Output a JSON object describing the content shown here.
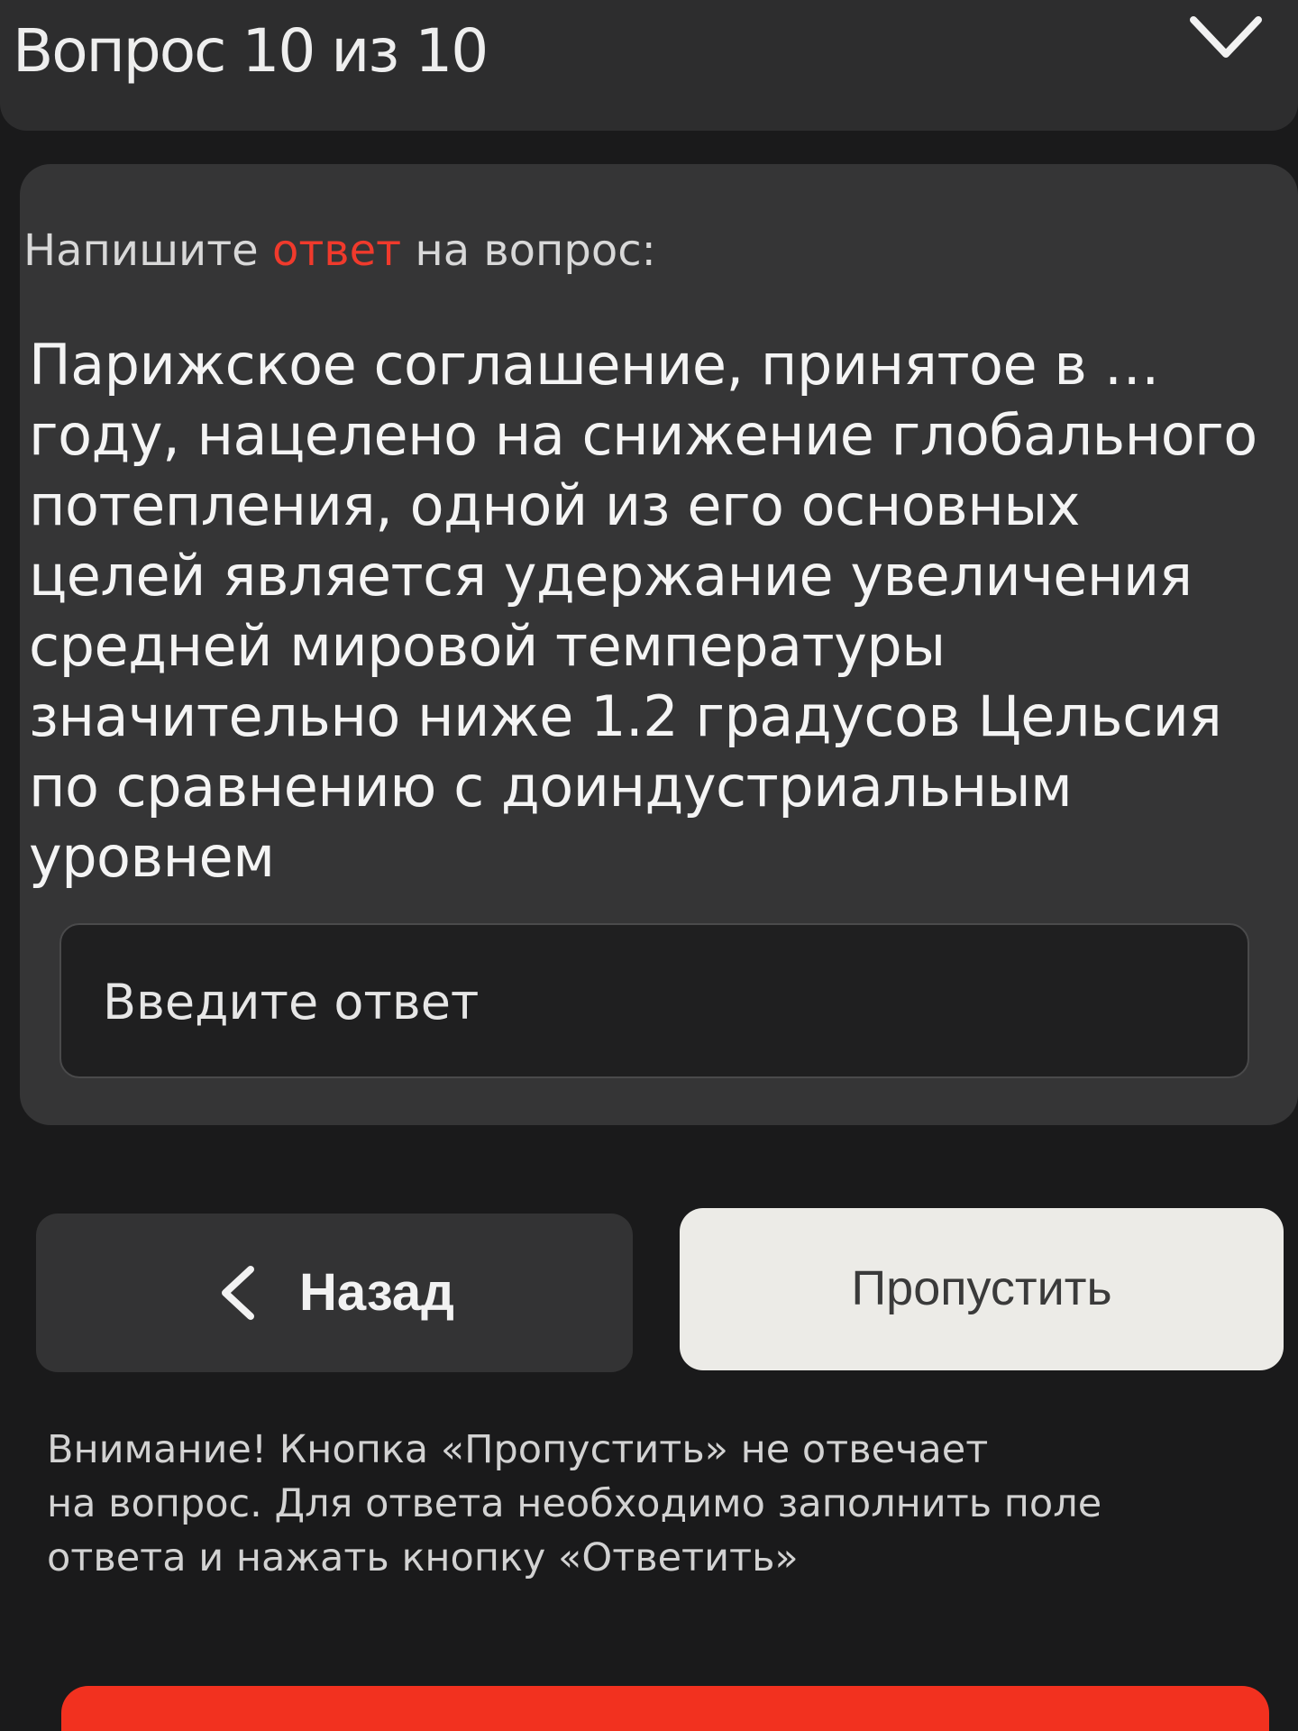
{
  "header": {
    "title": "Вопрос 10 из 10",
    "collapse_icon": "chevron-down-icon"
  },
  "card": {
    "instruction_before": "Напишите ",
    "instruction_accent": "ответ",
    "instruction_after": " на вопрос:",
    "question": "Парижское соглашение, принятое в … году, нацелено на снижение глобального потепления, одной из его основных целей является удержание увеличения средней мировой температуры значительно ниже 1.2 градусов Цельсия по сравнению с доиндустриальным уровнем",
    "answer_placeholder": "Введите ответ",
    "answer_value": ""
  },
  "buttons": {
    "back_label": "Назад",
    "back_icon": "chevron-left-icon",
    "skip_label": "Пропустить"
  },
  "warning": {
    "line1": "Внимание! Кнопка «Пропустить» не отвечает",
    "line2": "на вопрос. Для ответа необходимо заполнить поле",
    "line3": "ответа и нажать кнопку «Ответить»"
  },
  "colors": {
    "accent": "#f03a2c",
    "background": "#1a1a1b",
    "card": "#353536",
    "skip_button": "#ecebe7"
  }
}
